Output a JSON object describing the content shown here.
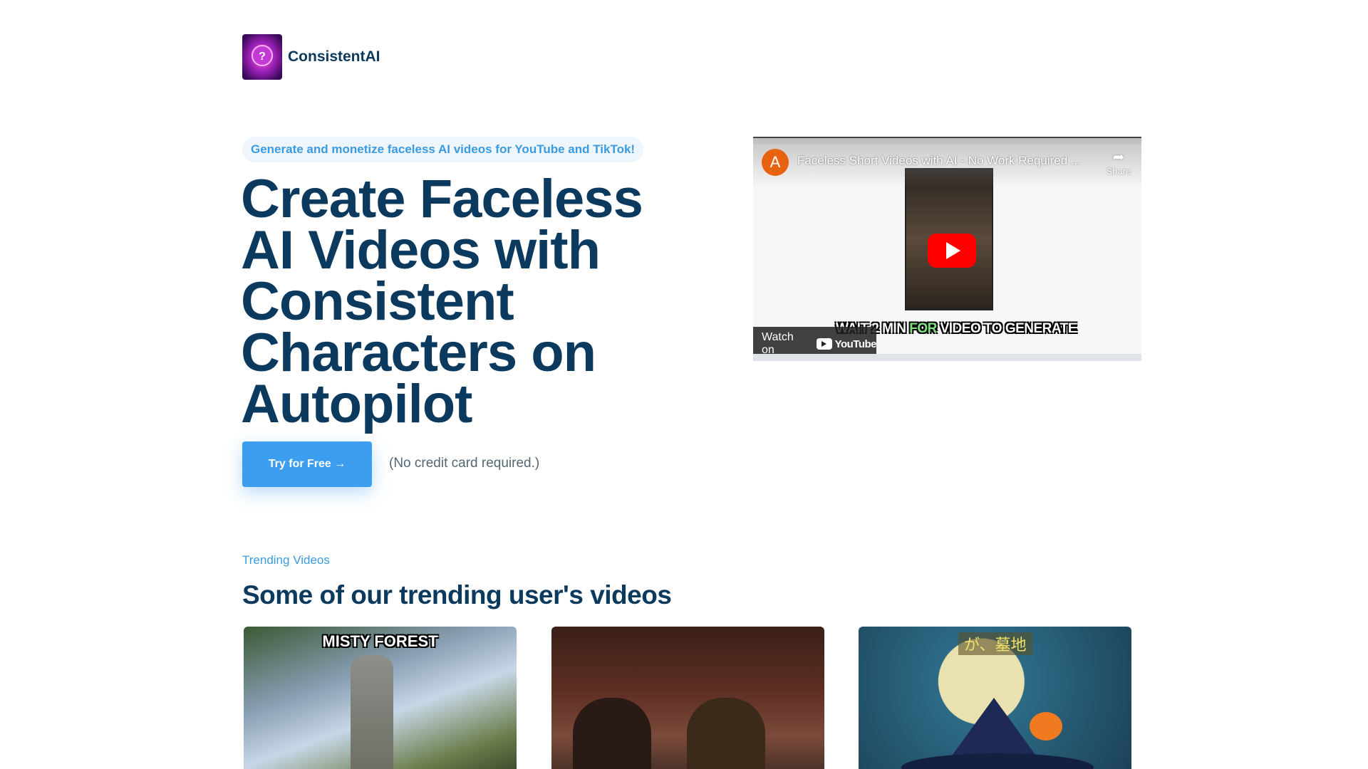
{
  "header": {
    "brand": "ConsistentAI",
    "logo_icon": "question-mark-logo-icon"
  },
  "hero": {
    "badge": "Generate and monetize faceless AI videos for YouTube and TikTok!",
    "title": "Create Faceless AI Videos with Consistent Characters on Autopilot",
    "cta_label": "Try for Free →",
    "cta_note": "(No credit card required.)"
  },
  "video": {
    "channel_initial": "A",
    "title": "Faceless Short Videos with AI - No Work Required ...",
    "share_label": "Share",
    "caption_part1": "WAIT 2 MIN ",
    "caption_highlight": "FOR",
    "caption_part2": " VIDEO TO GENERATE",
    "watch_on": "Watch on",
    "youtube_label": "YouTube",
    "accent_red": "#ff0000"
  },
  "trending": {
    "tag": "Trending Videos",
    "title": "Some of our trending user's videos",
    "cards": [
      {
        "label": "MISTY FOREST"
      },
      {
        "label": ""
      },
      {
        "label": "が、墓地"
      }
    ]
  },
  "colors": {
    "primary": "#3d9ef0",
    "heading": "#0c3a5e",
    "badge_bg": "#eef5fb"
  }
}
